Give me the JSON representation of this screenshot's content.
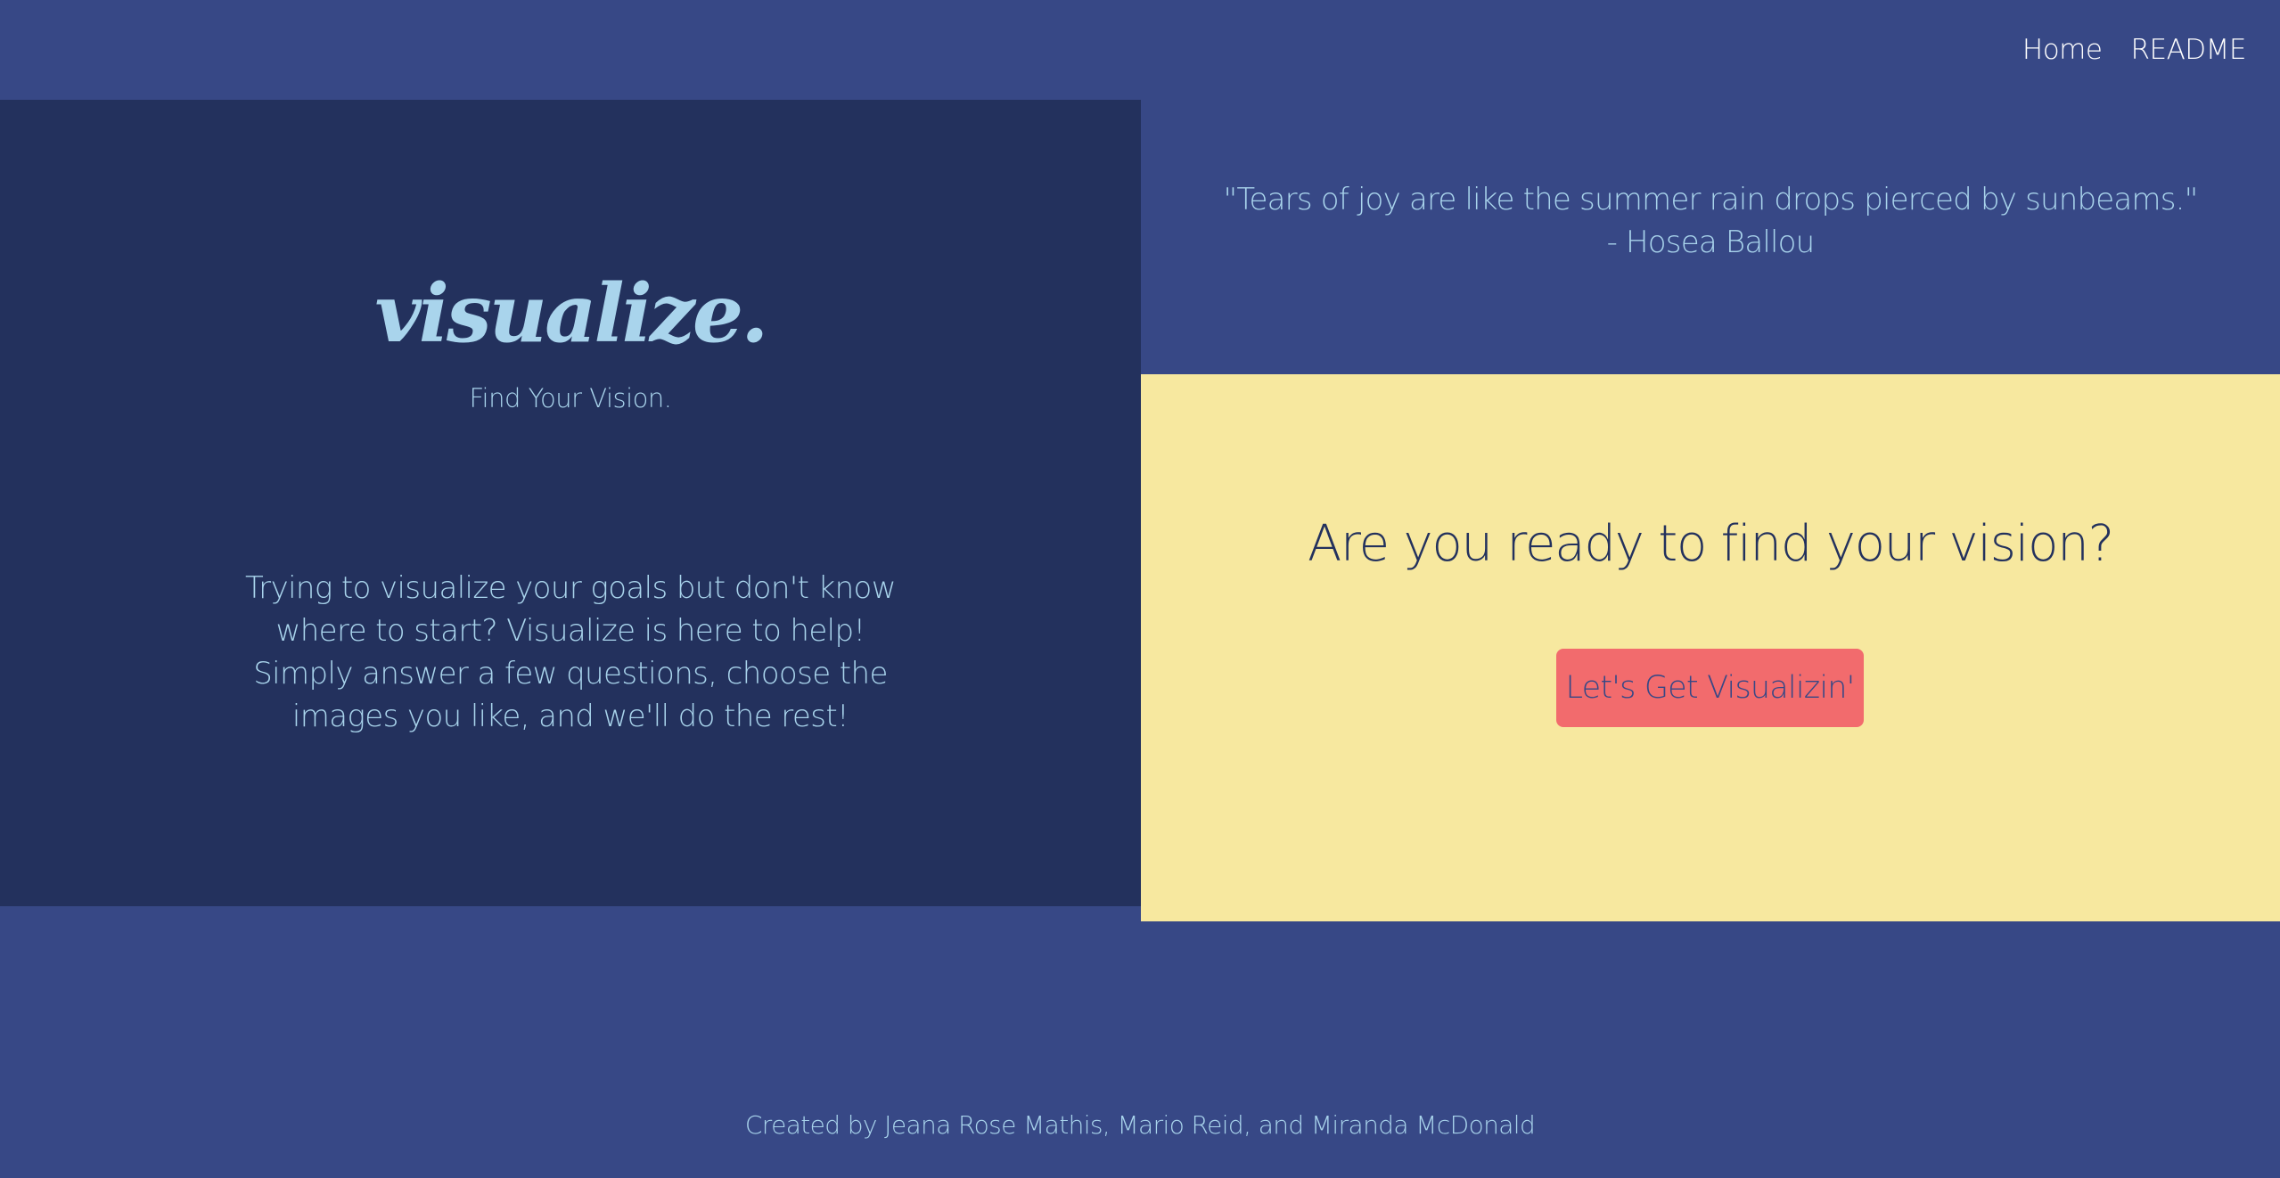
{
  "nav": {
    "items": [
      {
        "label": "Home"
      },
      {
        "label": "README"
      }
    ]
  },
  "hero": {
    "brand": "visualize.",
    "tagline": "Find Your Vision.",
    "intro": "Trying to visualize your goals but don't know where to start? Visualize is here to help! Simply answer a few questions, choose the images you like, and we'll do the rest!"
  },
  "quote": {
    "text": "\"Tears of joy are like the summer rain drops pierced by sunbeams.\"",
    "author": "- Hosea Ballou"
  },
  "cta": {
    "heading": "Are you ready to find your vision?",
    "button_label": "Let's Get Visualizin'"
  },
  "footer": {
    "credits": "Created by Jeana Rose Mathis, Mario Reid, and Miranda McDonald"
  },
  "colors": {
    "page_bg": "#374886",
    "left_panel_bg": "#23315d",
    "cta_panel_bg": "#f7e89f",
    "button_bg": "#f26b6d",
    "accent_text": "#a9d4ec",
    "dark_text": "#23315d"
  }
}
